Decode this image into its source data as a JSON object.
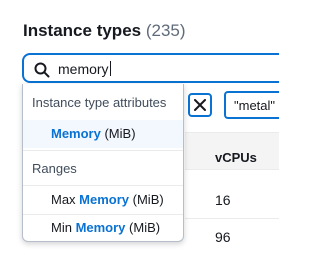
{
  "header": {
    "title": "Instance types",
    "count": "(235)"
  },
  "search": {
    "value": "memory",
    "icon": "search-icon"
  },
  "dropdown": {
    "groups": [
      {
        "label": "Instance type attributes",
        "options": [
          {
            "prefix": "",
            "match": "Memory",
            "suffix": " (MiB)"
          }
        ]
      },
      {
        "label": "Ranges",
        "options": [
          {
            "prefix": "Max ",
            "match": "Memory",
            "suffix": " (MiB)"
          },
          {
            "prefix": "Min ",
            "match": "Memory",
            "suffix": " (MiB)"
          }
        ]
      }
    ]
  },
  "background": {
    "clear_icon": "close-icon",
    "filter_token": "\"metal\"",
    "table": {
      "column_header": "vCPUs",
      "rows": [
        "16",
        "96"
      ]
    }
  },
  "colors": {
    "accent": "#0972d3",
    "text": "#16191f",
    "muted": "#5f6b7a"
  }
}
